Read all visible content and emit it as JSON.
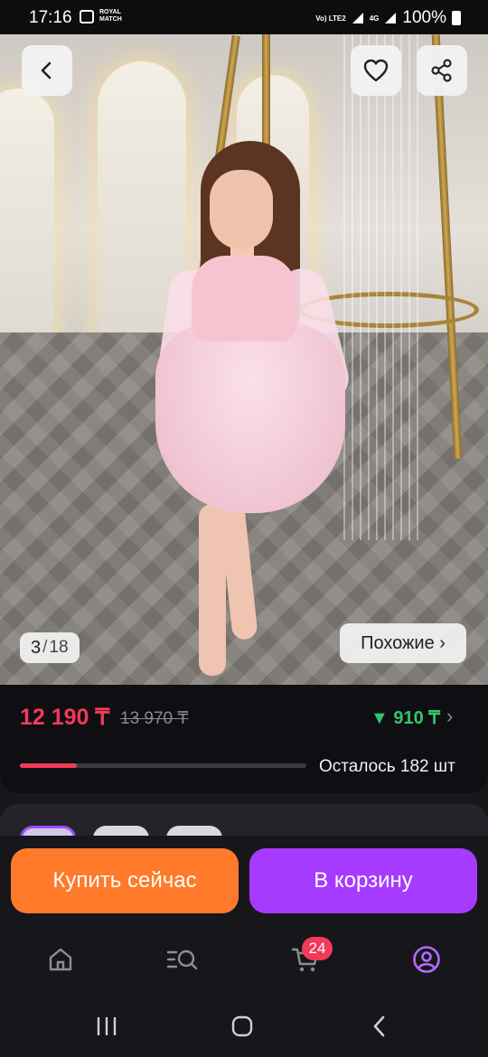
{
  "status_bar": {
    "time": "17:16",
    "app_notification_text": "ROYAL MATCH",
    "network_label": "Vo) LTE2",
    "network_type": "4G",
    "battery": "100%"
  },
  "product": {
    "image_index": "3",
    "image_separator": "/",
    "image_total": "18",
    "similar_label": "Похожие ›",
    "price": "12 190 ₸",
    "old_price": "13 970 ₸",
    "cashback": "▼ 910 ₸",
    "cashback_arrow": "›",
    "stock_text": "Осталось 182 шт",
    "stock_progress_percent": 20
  },
  "actions": {
    "buy_now_label": "Купить сейчас",
    "add_to_cart_label": "В корзину"
  },
  "tab_bar": {
    "cart_count": "24"
  },
  "colors": {
    "accent_red": "#f23a5a",
    "accent_purple": "#a63bff",
    "accent_orange": "#ff7a2a",
    "cashback_green": "#35c46a"
  },
  "icons": {
    "back": "chevron-left-icon",
    "favorite": "heart-icon",
    "share": "share-icon",
    "home": "home-icon",
    "catalog": "catalog-search-icon",
    "cart": "cart-icon",
    "profile": "profile-icon"
  }
}
